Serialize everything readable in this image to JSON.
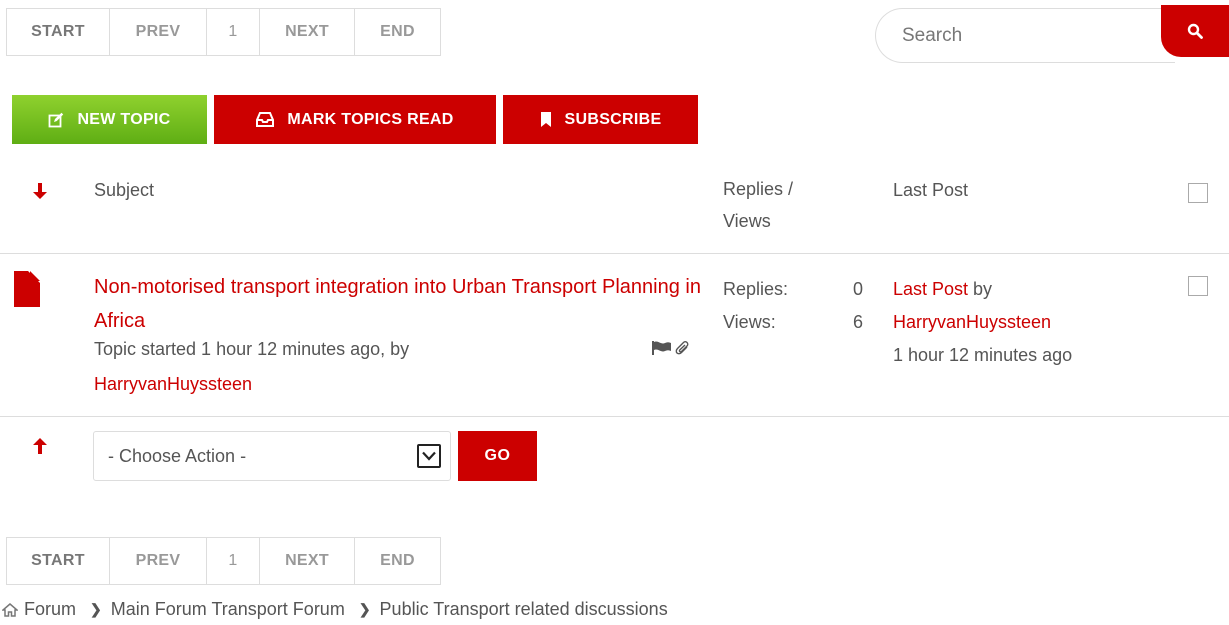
{
  "pagination": {
    "start": "START",
    "prev": "PREV",
    "page": "1",
    "next": "NEXT",
    "end": "END"
  },
  "search": {
    "placeholder": "Search",
    "icon": "search-icon"
  },
  "actions": {
    "new_topic": "NEW TOPIC",
    "mark_read": "MARK TOPICS READ",
    "subscribe": "SUBSCRIBE"
  },
  "table": {
    "headers": {
      "subject": "Subject",
      "replies_views": "Replies / Views",
      "last_post": "Last Post"
    },
    "topics": [
      {
        "title": "Non-motorised transport integration into Urban Transport Planning in Africa",
        "meta": "Topic started 1 hour 12 minutes ago, by",
        "author": "HarryvanHuyssteen",
        "replies_label": "Replies:",
        "replies": "0",
        "views_label": "Views:",
        "views": "6",
        "last_post_link": "Last Post",
        "last_post_by": " by",
        "last_post_author": "HarryvanHuyssteen",
        "last_post_time": "1 hour 12 minutes ago"
      }
    ]
  },
  "bulk": {
    "select_value": "- Choose Action -",
    "go": "GO"
  },
  "breadcrumbs": [
    "Forum",
    "Main Forum Transport Forum",
    "Public Transport related discussions"
  ],
  "colors": {
    "accent": "#cc0000",
    "green": "#6cbf1a",
    "text": "#555555",
    "border": "#dddddd"
  }
}
